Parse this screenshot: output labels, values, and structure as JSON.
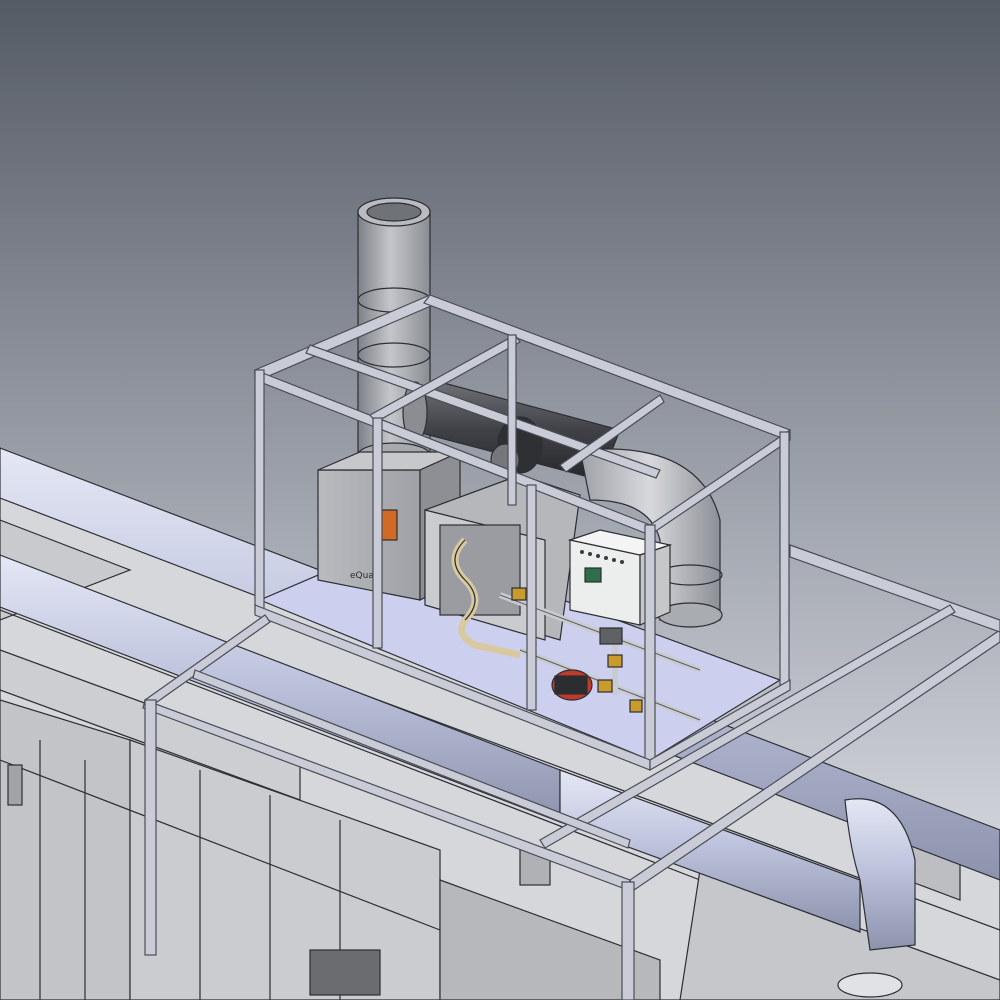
{
  "scene": {
    "background_top": "#555b65",
    "background_bottom": "#e7e9ee",
    "frame_color": "#c9ccd6",
    "pipe_color": "#bcc2dc",
    "floor_color": "#d7d8dc",
    "platform_color": "#ccd0ee",
    "flue_color": "#9da0a6",
    "pump_color": "#c23a2a"
  },
  "labels": {
    "unit_brand": "eQuat"
  }
}
